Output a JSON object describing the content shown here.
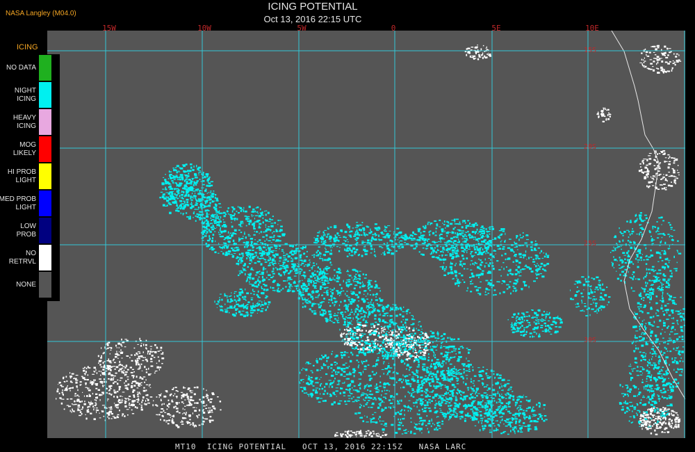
{
  "header": {
    "source": "NASA Langley (M04.0)",
    "title": "ICING POTENTIAL",
    "subtitle": "Oct 13, 2016 22:15 UTC"
  },
  "map": {
    "lon_labels": [
      "15W",
      "10W",
      "5W",
      "0",
      "5E",
      "10E"
    ],
    "lat_labels": [
      "15S",
      "20S",
      "25S",
      "30S"
    ],
    "colors": {
      "background": "#555555",
      "grid": "#33c8d6",
      "coast": "#e8e8e8",
      "cloud_icing": "#00f0f0",
      "cloud_noretrvl": "#ffffff",
      "label": "#c0282a"
    }
  },
  "legend": {
    "title": "ICING",
    "items": [
      {
        "label": "NO DATA",
        "color": "#1fb01f"
      },
      {
        "label": "NIGHT\nICING",
        "color": "#00f0f0"
      },
      {
        "label": "HEAVY\nICING",
        "color": "#e8a8e0"
      },
      {
        "label": "MOG\nLIKELY",
        "color": "#ff0000"
      },
      {
        "label": "HI PROB\nLIGHT",
        "color": "#ffff00"
      },
      {
        "label": "MED PROB\nLIGHT",
        "color": "#0000ff"
      },
      {
        "label": "LOW\nPROB",
        "color": "#000080"
      },
      {
        "label": "NO\nRETRVL",
        "color": "#ffffff"
      },
      {
        "label": "NONE",
        "color": "#555555"
      }
    ]
  },
  "footer": {
    "text": "MT10  ICING POTENTIAL   OCT 13, 2016 22:15Z   NASA LARC"
  }
}
